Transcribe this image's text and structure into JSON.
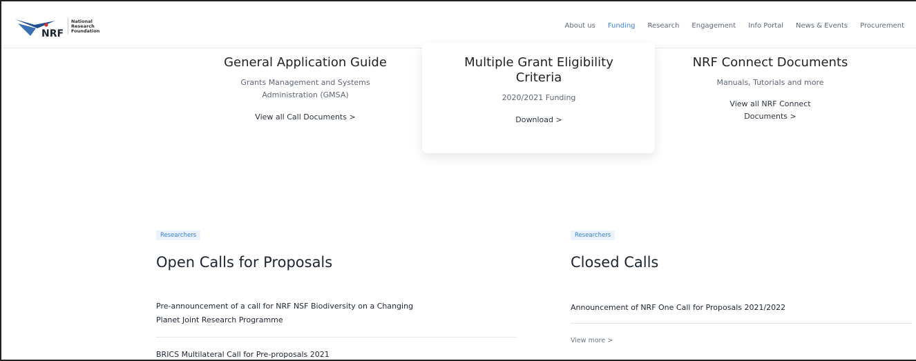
{
  "brand": {
    "mark": "NRF",
    "name_lines": [
      "National",
      "Research",
      "Foundation"
    ]
  },
  "nav": {
    "items": [
      "About us",
      "Funding",
      "Research",
      "Engagement",
      "Info Portal",
      "News & Events",
      "Procurement"
    ],
    "active": "Funding"
  },
  "cards": [
    {
      "title": "General Application Guide",
      "subtitle_lines": [
        "Grants Management and Systems",
        "Administration (GMSA)"
      ],
      "link": "View all Call Documents >"
    },
    {
      "title_lines": [
        "Multiple Grant Eligibility",
        "Criteria"
      ],
      "subtitle": "2020/2021 Funding",
      "link": "Download >"
    },
    {
      "title": "NRF Connect Documents",
      "subtitle": "Manuals, Tutorials and more",
      "link_lines": [
        "View all NRF Connect",
        "Documents >"
      ]
    }
  ],
  "open_calls": {
    "tag": "Researchers",
    "title": "Open Calls for Proposals",
    "items": [
      [
        "Pre-announcement of a call for NRF NSF Biodiversity on a Changing",
        "Planet Joint Research Programme"
      ],
      [
        "BRICS Multilateral Call for Pre-proposals 2021"
      ]
    ]
  },
  "closed_calls": {
    "tag": "Researchers",
    "title": "Closed Calls",
    "items": [
      "Announcement of NRF One Call for Proposals 2021/2022"
    ],
    "more": "View more >"
  }
}
